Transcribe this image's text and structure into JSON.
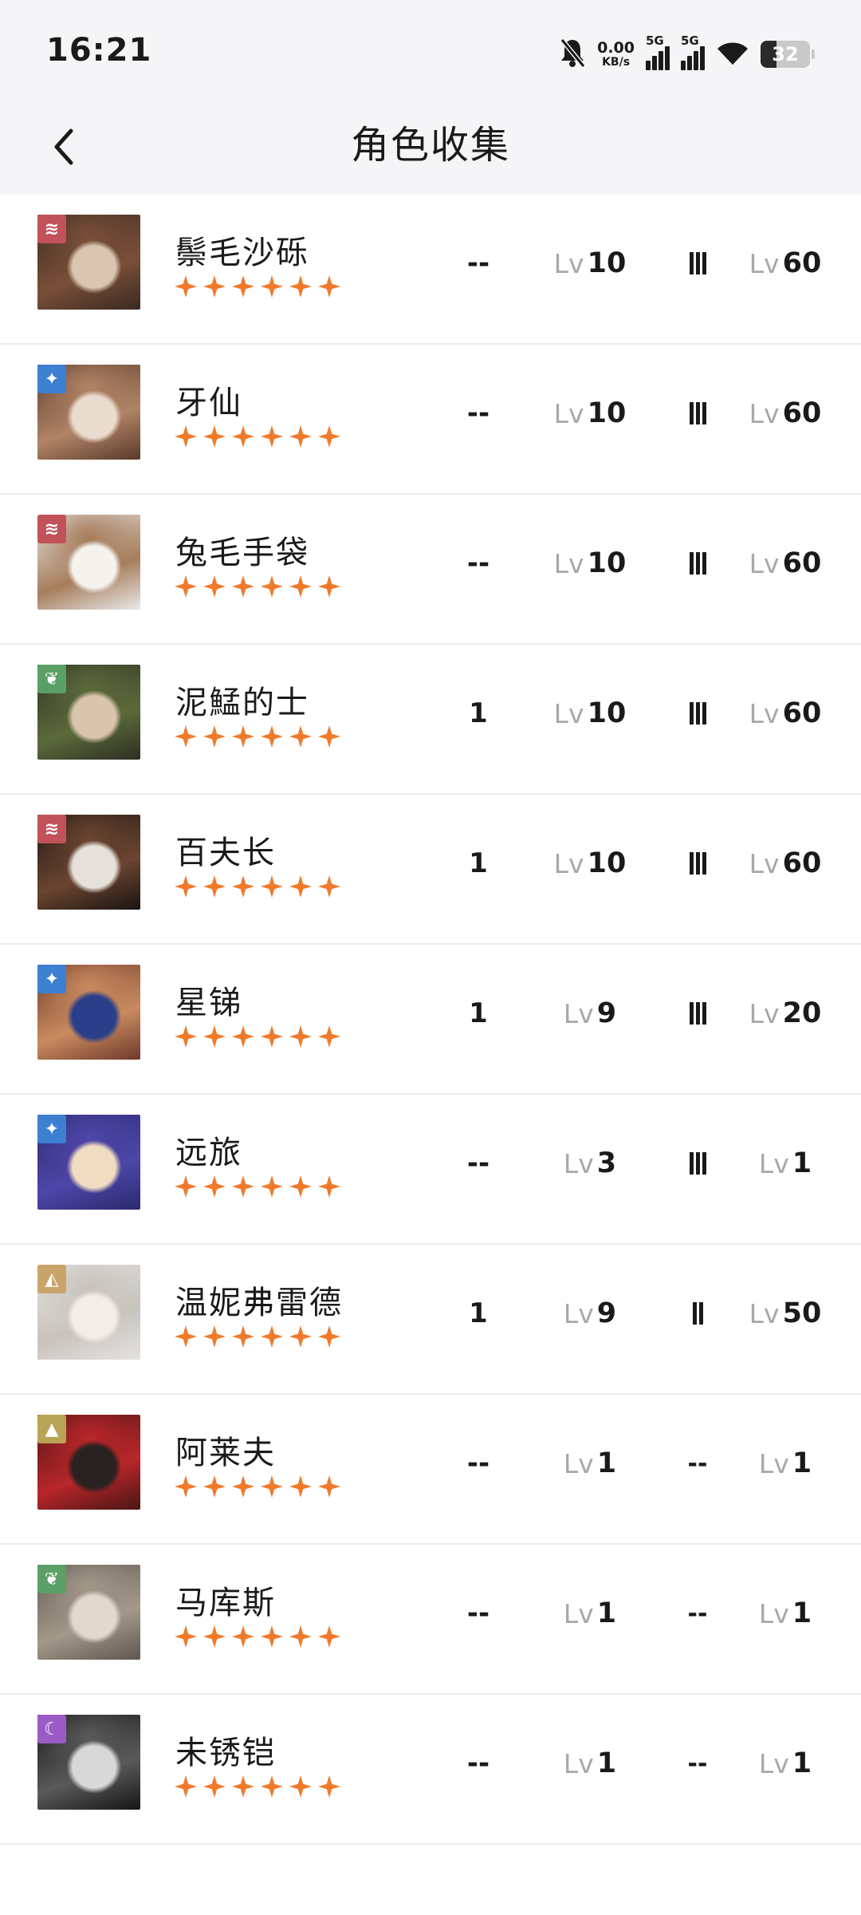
{
  "status_bar": {
    "time": "16:21",
    "net_speed_value": "0.00",
    "net_speed_unit": "KB/s",
    "sim1_label": "5G",
    "sim2_label": "5G",
    "battery": "32",
    "icons": [
      "mute-bell-icon",
      "signal-icon",
      "signal-icon",
      "wifi-icon",
      "battery-icon"
    ]
  },
  "header": {
    "title": "角色收集",
    "back_icon": "chevron-left-icon"
  },
  "lv_prefix": "Lv",
  "characters": [
    {
      "name": "鬃毛沙砾",
      "element": "beast",
      "element_color": "#c2525a",
      "stars": 6,
      "col1": "--",
      "level": "10",
      "tier": "III",
      "tier_count": 3,
      "level2": "60",
      "portrait_colors": [
        "#3a2a22",
        "#7a4f38",
        "#d8c6b0"
      ]
    },
    {
      "name": "牙仙",
      "element": "star",
      "element_color": "#3d7fd1",
      "stars": 6,
      "col1": "--",
      "level": "10",
      "tier": "III",
      "tier_count": 3,
      "level2": "60",
      "portrait_colors": [
        "#5a3a2a",
        "#b08466",
        "#eadbcf"
      ]
    },
    {
      "name": "兔毛手袋",
      "element": "beast",
      "element_color": "#c2525a",
      "stars": 6,
      "col1": "--",
      "level": "10",
      "tier": "III",
      "tier_count": 3,
      "level2": "60",
      "portrait_colors": [
        "#e8e8ea",
        "#a67d5a",
        "#f5f3ee"
      ]
    },
    {
      "name": "泥鯭的士",
      "element": "plant",
      "element_color": "#5aa066",
      "stars": 6,
      "col1": "1",
      "level": "10",
      "tier": "III",
      "tier_count": 3,
      "level2": "60",
      "portrait_colors": [
        "#2d2f24",
        "#5c6a3a",
        "#d9c4ac"
      ]
    },
    {
      "name": "百夫长",
      "element": "beast",
      "element_color": "#c2525a",
      "stars": 6,
      "col1": "1",
      "level": "10",
      "tier": "III",
      "tier_count": 3,
      "level2": "60",
      "portrait_colors": [
        "#1a1412",
        "#6b4530",
        "#e6e0da"
      ]
    },
    {
      "name": "星锑",
      "element": "star",
      "element_color": "#3d7fd1",
      "stars": 6,
      "col1": "1",
      "level": "9",
      "tier": "III",
      "tier_count": 3,
      "level2": "20",
      "portrait_colors": [
        "#6e3a2c",
        "#c98a5e",
        "#2a3e8a"
      ]
    },
    {
      "name": "远旅",
      "element": "star",
      "element_color": "#3d7fd1",
      "stars": 6,
      "col1": "--",
      "level": "3",
      "tier": "III",
      "tier_count": 3,
      "level2": "1",
      "portrait_colors": [
        "#2c2a6e",
        "#4e46a8",
        "#f0dcc0"
      ]
    },
    {
      "name": "温妮弗雷德",
      "element": "mineral",
      "element_color": "#c9a46a",
      "stars": 6,
      "col1": "1",
      "level": "9",
      "tier": "II",
      "tier_count": 2,
      "level2": "50",
      "portrait_colors": [
        "#e4e2e0",
        "#c9c3bd",
        "#f4ece6"
      ]
    },
    {
      "name": "阿莱夫",
      "element": "intellect",
      "element_color": "#b9a455",
      "stars": 6,
      "col1": "--",
      "level": "1",
      "tier": "--",
      "tier_count": 0,
      "level2": "1",
      "portrait_colors": [
        "#4a1614",
        "#b8262a",
        "#2a2220"
      ]
    },
    {
      "name": "马库斯",
      "element": "plant",
      "element_color": "#5aa066",
      "stars": 6,
      "col1": "--",
      "level": "1",
      "tier": "--",
      "tier_count": 0,
      "level2": "1",
      "portrait_colors": [
        "#5e5650",
        "#a39889",
        "#e2d8cc"
      ]
    },
    {
      "name": "未锈铠",
      "element": "spirit",
      "element_color": "#9a5cc4",
      "stars": 6,
      "col1": "--",
      "level": "1",
      "tier": "--",
      "tier_count": 0,
      "level2": "1",
      "portrait_colors": [
        "#161616",
        "#5a5a5a",
        "#d8d8d8"
      ]
    }
  ]
}
